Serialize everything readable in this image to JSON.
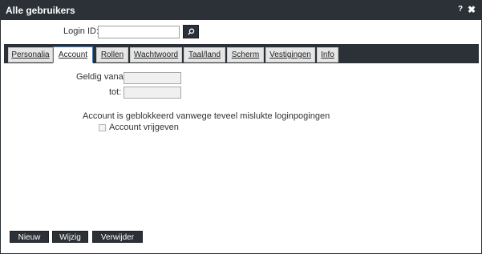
{
  "window": {
    "title": "Alle gebruikers",
    "help": "?",
    "close": "✖"
  },
  "login": {
    "label": "Login ID:",
    "value": "",
    "placeholder": ""
  },
  "tabs": [
    {
      "label": "Personalia",
      "active": false
    },
    {
      "label": "Account",
      "active": true
    },
    {
      "label": "Rollen",
      "active": false
    },
    {
      "label": "Wachtwoord",
      "active": false
    },
    {
      "label": "Taal/land",
      "active": false
    },
    {
      "label": "Scherm",
      "active": false
    },
    {
      "label": "Vestigingen",
      "active": false
    },
    {
      "label": "Info",
      "active": false
    }
  ],
  "account": {
    "valid_from_label": "Geldig vanaf:",
    "valid_from_value": "",
    "valid_to_label": "tot:",
    "valid_to_value": "",
    "blocked_message": "Account is geblokkeerd vanwege teveel mislukte loginpogingen",
    "release_label": "Account vrijgeven",
    "release_checked": false
  },
  "buttons": {
    "new": "Nieuw",
    "edit": "Wijzig",
    "delete": "Verwijder"
  },
  "colors": {
    "chrome": "#2b3136",
    "tab_active_border": "#4a7ab5"
  },
  "icons": {
    "search": "search-icon"
  }
}
